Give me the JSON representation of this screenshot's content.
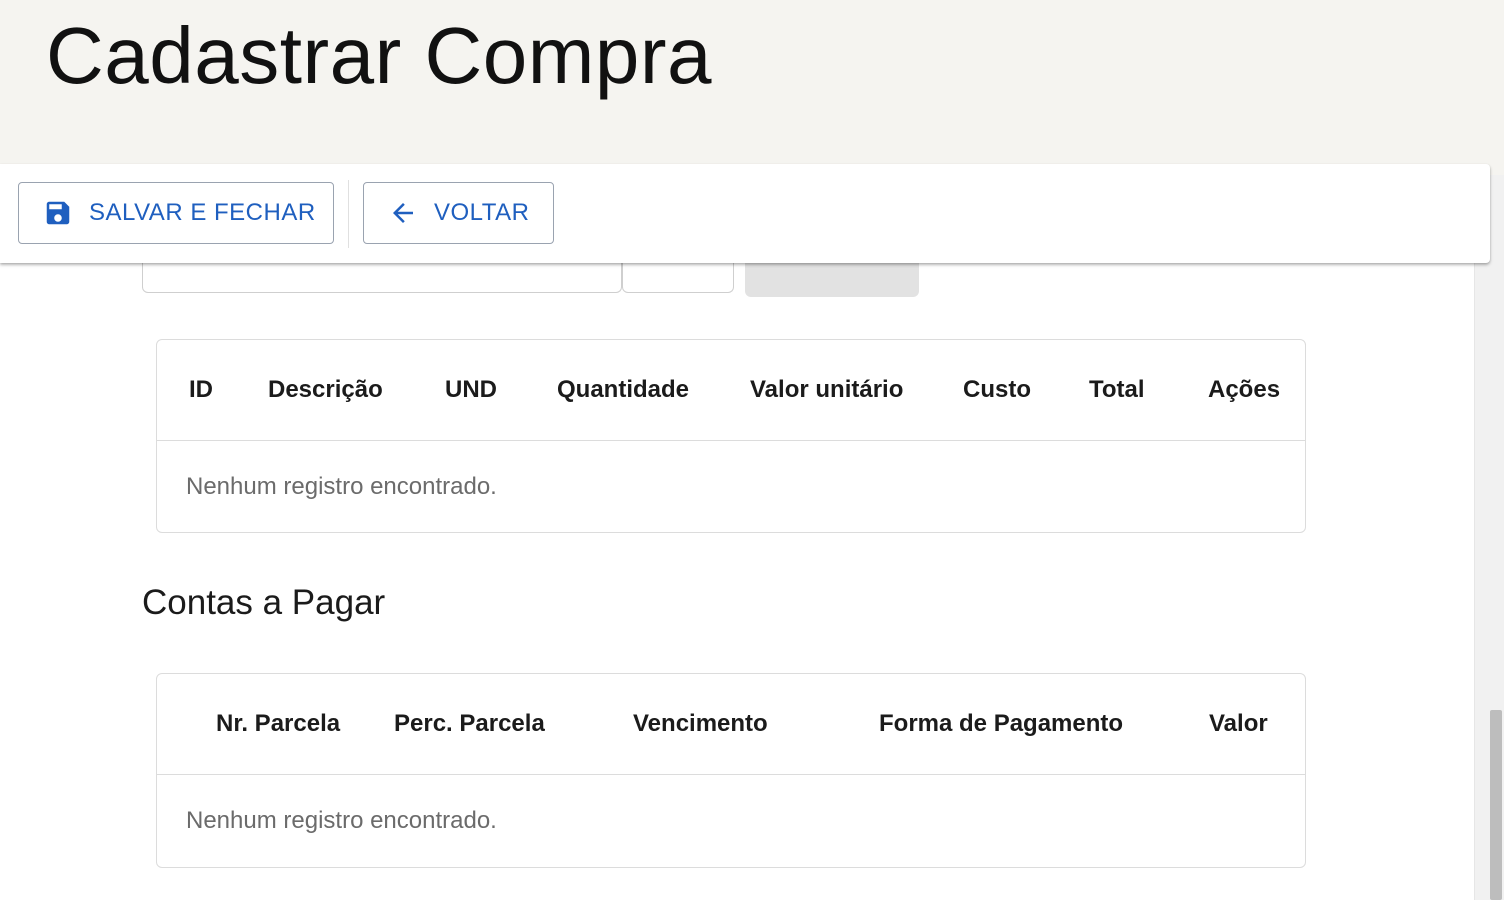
{
  "page": {
    "title": "Cadastrar Compra"
  },
  "toolbar": {
    "save_label": "SALVAR E FECHAR",
    "save_icon": "save-icon",
    "back_label": "VOLTAR",
    "back_icon": "arrow-left-icon",
    "accent_color": "#1f5fbf"
  },
  "items_table": {
    "columns": [
      "ID",
      "Descrição",
      "UND",
      "Quantidade",
      "Valor unitário",
      "Custo",
      "Total",
      "Ações"
    ],
    "empty_message": "Nenhum registro encontrado."
  },
  "bills_section": {
    "title": "Contas a Pagar"
  },
  "bills_table": {
    "columns": [
      "Nr. Parcela",
      "Perc. Parcela",
      "Vencimento",
      "Forma de Pagamento",
      "Valor"
    ],
    "empty_message": "Nenhum registro encontrado."
  }
}
